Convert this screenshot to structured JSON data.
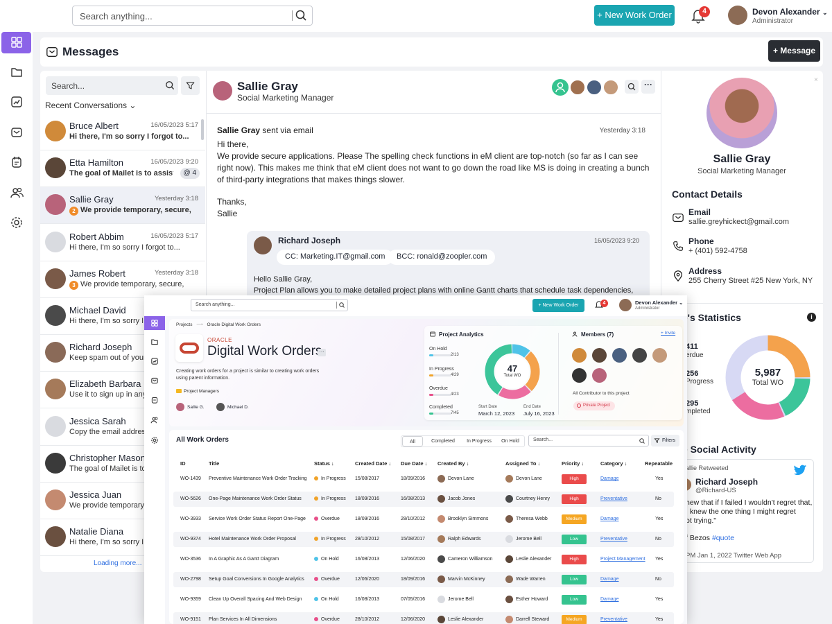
{
  "topbar": {
    "search_placeholder": "Search anything...",
    "new_work_order": "+ New Work Order",
    "notifications": "4",
    "user_name": "Devon Alexander",
    "user_role": "Administrator"
  },
  "messages": {
    "title": "Messages",
    "new_message": "+ Message",
    "search_placeholder": "Search...",
    "recent_label": "Recent Conversations",
    "loading": "Loading more...",
    "conversations": [
      {
        "name": "Bruce Albert",
        "date": "16/05/2023 5:17",
        "preview": "Hi there, I'm so sorry I forgot to...",
        "bold": true,
        "avatar_color": "#d08a3a"
      },
      {
        "name": "Etta Hamilton",
        "date": "16/05/2023 9:20",
        "preview": "The goal of Mailet is to assist dev...",
        "bold": true,
        "badge": "4",
        "avatar_color": "#5a4638"
      },
      {
        "name": "Sallie Gray",
        "date": "Yesterday 3:18",
        "preview": "We provide temporary, secure,",
        "bold": true,
        "count": "2",
        "avatar_color": "#b8637a"
      },
      {
        "name": "Robert Abbim",
        "date": "16/05/2023 5:17",
        "preview": "Hi there, I'm so sorry I forgot to...",
        "bold": false,
        "avatar_color": "#d9dbe0"
      },
      {
        "name": "James Robert",
        "date": "Yesterday 3:18",
        "preview": "We provide temporary, secure,",
        "bold": false,
        "count": "3",
        "avatar_color": "#7a5a48"
      },
      {
        "name": "Michael David",
        "date": "",
        "preview": "Hi there, I'm so sorry I for",
        "bold": false,
        "avatar_color": "#4a4a4a"
      },
      {
        "name": "Richard Joseph",
        "date": "",
        "preview": "Keep spam out of your m",
        "bold": false,
        "avatar_color": "#8a6a58"
      },
      {
        "name": "Elizabeth Barbara",
        "date": "",
        "preview": "Use it to sign up in any on",
        "bold": false,
        "avatar_color": "#a57a5a"
      },
      {
        "name": "Jessica Sarah",
        "date": "",
        "preview": "Copy the email address t",
        "bold": false,
        "avatar_color": "#d9dbe0"
      },
      {
        "name": "Christopher Mason",
        "date": "",
        "preview": "The goal of Mailet is to as",
        "bold": false,
        "avatar_color": "#3a3a3a"
      },
      {
        "name": "Jessica Juan",
        "date": "",
        "preview": "We provide temporary, se",
        "bold": false,
        "avatar_color": "#c48a70"
      },
      {
        "name": "Natalie Diana",
        "date": "",
        "preview": "Hi there, I'm so sorry I for",
        "bold": false,
        "avatar_color": "#6a5040"
      }
    ]
  },
  "chat": {
    "name": "Sallie Gray",
    "role": "Social Marketing Manager",
    "sender": "Sallie Gray",
    "sent_via": "sent via email",
    "time": "Yesterday 3:18",
    "greeting": "Hi there,",
    "body": "We provide secure applications. Please The spelling check functions in eM client are top-notch (so far as I can see right now). This makes me think that eM client does not want to go down the road like MS is doing in creating a bunch of third-party integrations that makes things slower.",
    "signoff1": "Thanks,",
    "signoff2": "Sallie",
    "reply": {
      "name": "Richard Joseph",
      "time": "16/05/2023 9:20",
      "cc": "CC: Marketing.IT@gmail.com",
      "bcc": "BCC: ronald@zoopler.com",
      "greeting": "Hello Sallie Gray,",
      "body": "Project Plan allows you to make detailed project plans with online Gantt charts that schedule task dependencies,"
    }
  },
  "profile": {
    "name": "Sallie Gray",
    "role": "Social Marketing Manager",
    "contact_title": "Contact Details",
    "email_label": "Email",
    "email": "sallie.greyhickect@gmail.com",
    "phone_label": "Phone",
    "phone": "+ (401) 592-4758",
    "address_label": "Address",
    "address": "255 Cherry Street #25 New York, NY",
    "stats_title": "ie's Statistics",
    "stats": [
      {
        "num": "411",
        "label": "erdue"
      },
      {
        "num": "256",
        "label": "Progress"
      },
      {
        "num": "295",
        "label": "mpleted"
      }
    ],
    "total_num": "5,987",
    "total_label": "Total WO",
    "social_title": "ie Social Activity",
    "retweet": "allie Retweeted",
    "tweet_name": "Richard Joseph",
    "tweet_handle": "@Richard-US",
    "tweet_text1": "new that if I failed I wouldn't regret that,",
    "tweet_text2": "I knew the one thing I might regret",
    "tweet_text3": "ot trying.\"",
    "tweet_author": "f Bezos",
    "tweet_tag": "#quote",
    "tweet_meta": "PM Jan 1, 2022 Twitter Web App"
  },
  "workorders": {
    "search_placeholder": "Search anything...",
    "new_work_order": "+ New Work Order",
    "notifications": "4",
    "user_name": "Devon Alexander",
    "user_role": "Administrator",
    "crumb1": "Projects",
    "crumb2": "Oracle Digital Work Orders",
    "brand": "ORACLE",
    "title": "Digital Work Orders",
    "desc1": "Creating work orders for a project is similar to creating work orders",
    "desc2": "using parent information.",
    "folder": "Project Managers",
    "manager1": "Sallie G.",
    "manager2": "Michael D.",
    "analytics_title": "Project Analytics",
    "members_title": "Members (7)",
    "invite": "+ Invite",
    "contributor": "All Contributor to this project",
    "private": "Private Project",
    "start_label": "Start Date",
    "start_date": "March 12, 2023",
    "end_label": "End Date",
    "end_date": "July 16, 2023",
    "total_num": "47",
    "total_label": "Total WO",
    "list_title": "All Work Orders",
    "search_list": "Search...",
    "filters_label": "Filters",
    "filters": [
      "All",
      "Completed",
      "In Progress",
      "On Hold"
    ],
    "columns": [
      "ID",
      "Title",
      "Status",
      "Created Date",
      "Due Date",
      "Created By",
      "Assigned To",
      "Priority",
      "Category",
      "Repeatable"
    ]
  },
  "chart_data": {
    "type": "pie",
    "title": "Project Analytics",
    "categories": [
      "On Hold",
      "In Progress",
      "Overdue",
      "Completed"
    ],
    "values": [
      2,
      4,
      4,
      7
    ],
    "totals": [
      13,
      29,
      23,
      45
    ],
    "center_value": 47,
    "center_label": "Total WO"
  },
  "rows": [
    {
      "id": "WO-1439",
      "title": "Preventive Maintenance Work Order Tracking",
      "status": "In Progress",
      "status_color": "#f0a32a",
      "created": "15/08/2017",
      "due": "18/09/2016",
      "by": "Devon Lane",
      "to": "Devon Lane",
      "prio": "High",
      "prio_color": "#ea4b4b",
      "cat": "Damage",
      "rep": "Yes"
    },
    {
      "id": "WO-5626",
      "title": "One-Page Maintenance Work Order Status",
      "status": "In Progress",
      "status_color": "#f0a32a",
      "created": "18/09/2016",
      "due": "16/08/2013",
      "by": "Jacob Jones",
      "to": "Courtney Henry",
      "prio": "High",
      "prio_color": "#ea4b4b",
      "cat": "Preventative",
      "rep": "No"
    },
    {
      "id": "WO-3933",
      "title": "Service Work Order Status Report One-Page",
      "status": "Overdue",
      "status_color": "#e8508a",
      "created": "18/09/2016",
      "due": "28/10/2012",
      "by": "Brooklyn Simmons",
      "to": "Theresa Webb",
      "prio": "Medium",
      "prio_color": "#f5a623",
      "cat": "Damage",
      "rep": "Yes"
    },
    {
      "id": "WO-9374",
      "title": "Hotel Maintenance Work Order Proposal",
      "status": "In Progress",
      "status_color": "#f0a32a",
      "created": "28/10/2012",
      "due": "15/08/2017",
      "by": "Ralph Edwards",
      "to": "Jerome Bell",
      "prio": "Low",
      "prio_color": "#35c38f",
      "cat": "Preventative",
      "rep": "No"
    },
    {
      "id": "WO-3536",
      "title": "In A Graphic As A Gantt Diagram",
      "status": "On Hold",
      "status_color": "#4fc3e8",
      "created": "16/08/2013",
      "due": "12/06/2020",
      "by": "Cameron Williamson",
      "to": "Leslie Alexander",
      "prio": "High",
      "prio_color": "#ea4b4b",
      "cat": "Project Management",
      "rep": "Yes"
    },
    {
      "id": "WO-2798",
      "title": "Setup Goal Conversions In Google Analytics",
      "status": "Overdue",
      "status_color": "#e8508a",
      "created": "12/06/2020",
      "due": "18/09/2016",
      "by": "Marvin McKinney",
      "to": "Wade Warren",
      "prio": "Low",
      "prio_color": "#35c38f",
      "cat": "Damage",
      "rep": "No"
    },
    {
      "id": "WO-9359",
      "title": "Clean Up Overall Spacing And Web Design",
      "status": "On Hold",
      "status_color": "#4fc3e8",
      "created": "16/08/2013",
      "due": "07/05/2016",
      "by": "Jerome Bell",
      "to": "Esther Howard",
      "prio": "Low",
      "prio_color": "#35c38f",
      "cat": "Damage",
      "rep": "Yes"
    },
    {
      "id": "WO-9151",
      "title": "Plan Services In All Dimensions",
      "status": "Overdue",
      "status_color": "#e8508a",
      "created": "28/10/2012",
      "due": "12/06/2020",
      "by": "Leslie Alexander",
      "to": "Darrell Steward",
      "prio": "Medium",
      "prio_color": "#f5a623",
      "cat": "Preventative",
      "rep": "Yes"
    }
  ]
}
